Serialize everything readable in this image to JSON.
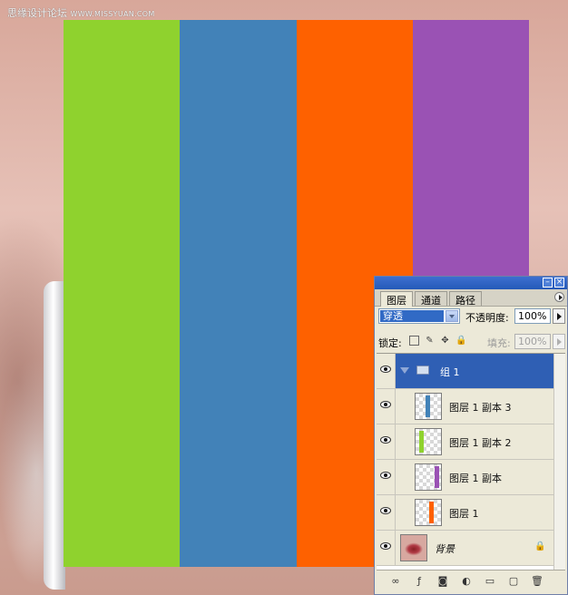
{
  "watermark": {
    "site_name": "思缘设计论坛",
    "url": "WWW.MISSYUAN.COM"
  },
  "canvas": {
    "stripes": [
      {
        "name": "green-stripe",
        "color": "#8fd22e"
      },
      {
        "name": "blue-stripe",
        "color": "#4282b8"
      },
      {
        "name": "orange-stripe",
        "color": "#fe6100"
      },
      {
        "name": "purple-stripe",
        "color": "#9a52b4"
      }
    ]
  },
  "layers_panel": {
    "tabs": [
      {
        "label": "图层",
        "active": true
      },
      {
        "label": "通道",
        "active": false
      },
      {
        "label": "路径",
        "active": false
      }
    ],
    "blend_mode": "穿透",
    "opacity_label": "不透明度:",
    "opacity_value": "100%",
    "lock_label": "锁定:",
    "fill_label": "填充:",
    "fill_value": "100%",
    "layers": [
      {
        "name": "组 1",
        "type": "group",
        "selected": true
      },
      {
        "name": "图层 1 副本 3",
        "type": "layer",
        "thumb_color": "#4282b8"
      },
      {
        "name": "图层 1 副本 2",
        "type": "layer",
        "thumb_color": "#8fd22e"
      },
      {
        "name": "图层 1 副本",
        "type": "layer",
        "thumb_color": "#9a52b4"
      },
      {
        "name": "图层 1",
        "type": "layer",
        "thumb_color": "#fe6100"
      },
      {
        "name": "背景",
        "type": "background",
        "locked": true
      }
    ],
    "icons": [
      "minimize-icon",
      "close-icon",
      "panel-menu-icon",
      "link-icon",
      "fx-icon",
      "mask-icon",
      "adjustment-icon",
      "new-group-icon",
      "new-layer-icon",
      "trash-icon"
    ]
  }
}
